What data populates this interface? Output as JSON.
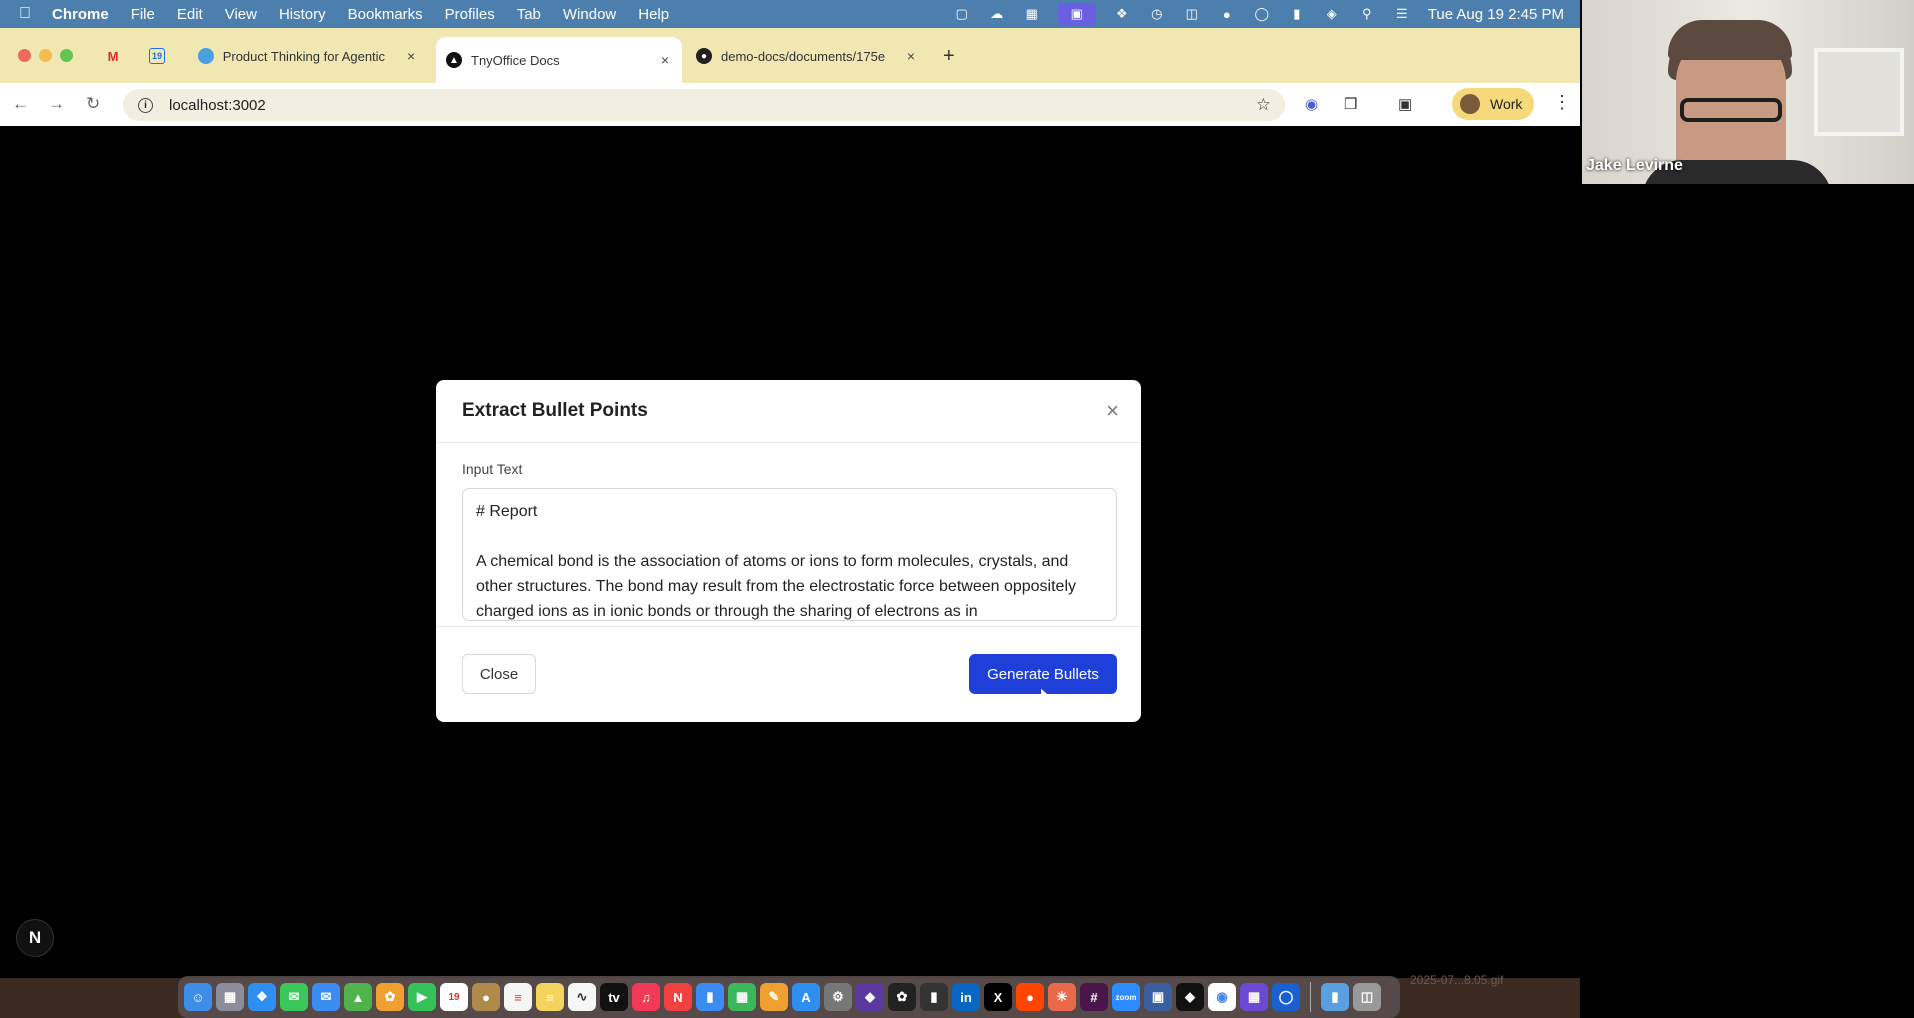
{
  "menubar": {
    "app": "Chrome",
    "items": [
      "File",
      "Edit",
      "View",
      "History",
      "Bookmarks",
      "Profiles",
      "Tab",
      "Window",
      "Help"
    ],
    "datetime": "Tue Aug 19  2:45 PM"
  },
  "tabs": [
    {
      "title": "Product Thinking for Agentic",
      "close": "×"
    },
    {
      "title": "TnyOffice Docs",
      "close": "×"
    },
    {
      "title": "demo-docs/documents/175e",
      "close": "×"
    }
  ],
  "newtab": "+",
  "omnibox": {
    "url": "localhost:3002"
  },
  "profile": {
    "label": "Work"
  },
  "modal": {
    "title": "Extract Bullet Points",
    "close_icon": "×",
    "input_label": "Input Text",
    "input_value": "# Report\n\nA chemical bond is the association of atoms or ions to form molecules, crystals, and other structures. The bond may result from the electrostatic force between oppositely charged ions as in ionic bonds or through the sharing of electrons as in",
    "close_button": "Close",
    "generate_button": "Generate Bullets"
  },
  "next_badge": "N",
  "webcam": {
    "name": "Jake Levirne"
  },
  "dock_file_label": "2025-07...8.05.gif",
  "colors": {
    "accent": "#1e40d8",
    "menubar": "#4d7fae",
    "tabstrip": "#f0e7b3"
  }
}
